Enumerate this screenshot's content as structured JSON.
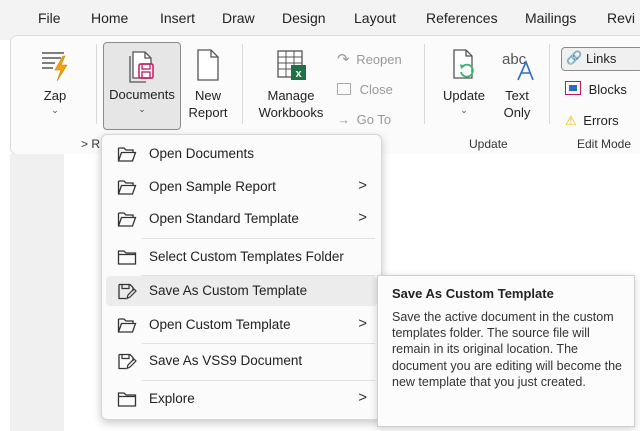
{
  "menubar": {
    "items": [
      "File",
      "Home",
      "Insert",
      "Draw",
      "Design",
      "Layout",
      "References",
      "Mailings",
      "Revi"
    ]
  },
  "ribbon": {
    "zap": {
      "label": "Zap"
    },
    "documents": {
      "label": "Documents"
    },
    "new_report": {
      "line1": "New",
      "line2": "Report"
    },
    "manage_workbooks": {
      "line1": "Manage",
      "line2": "Workbooks"
    },
    "reopen": "Reopen",
    "close": "Close",
    "go_to": "Go To",
    "update": {
      "label": "Update"
    },
    "text_only": {
      "line1": "Text",
      "line2": "Only"
    },
    "links": "Links",
    "blocks": "Blocks",
    "errors": "Errors",
    "groups": {
      "first": "> R",
      "update": "Update",
      "edit_mode": "Edit Mode"
    }
  },
  "dropdown": {
    "items": [
      {
        "label": "Open Documents",
        "icon": "folder-open-icon",
        "submenu": false
      },
      {
        "label": "Open Sample Report",
        "icon": "folder-open-icon",
        "submenu": true
      },
      {
        "label": "Open Standard Template",
        "icon": "folder-open-icon",
        "submenu": true
      },
      {
        "label": "Select Custom Templates Folder",
        "icon": "folder-icon",
        "submenu": false
      },
      {
        "label": "Save As Custom Template",
        "icon": "save-as-icon",
        "submenu": false,
        "highlighted": true
      },
      {
        "label": "Open Custom Template",
        "icon": "folder-open-icon",
        "submenu": true
      },
      {
        "label": "Save As VSS9 Document",
        "icon": "save-as-icon",
        "submenu": false
      },
      {
        "label": "Explore",
        "icon": "folder-icon",
        "submenu": true
      }
    ],
    "arrow_glyph": ">"
  },
  "tooltip": {
    "title": "Save As Custom Template",
    "body": "Save the active document in the custom templates folder. The source file will remain in its original location. The document you are editing will become the new template that you just created."
  },
  "colors": {
    "zap_orange": "#f0a30a",
    "documents_pink": "#c2185b",
    "excel_green": "#1e7145",
    "update_green": "#3cb371",
    "text_only_blue": "#2b6cc4",
    "errors_yellow": "#f3b300"
  }
}
